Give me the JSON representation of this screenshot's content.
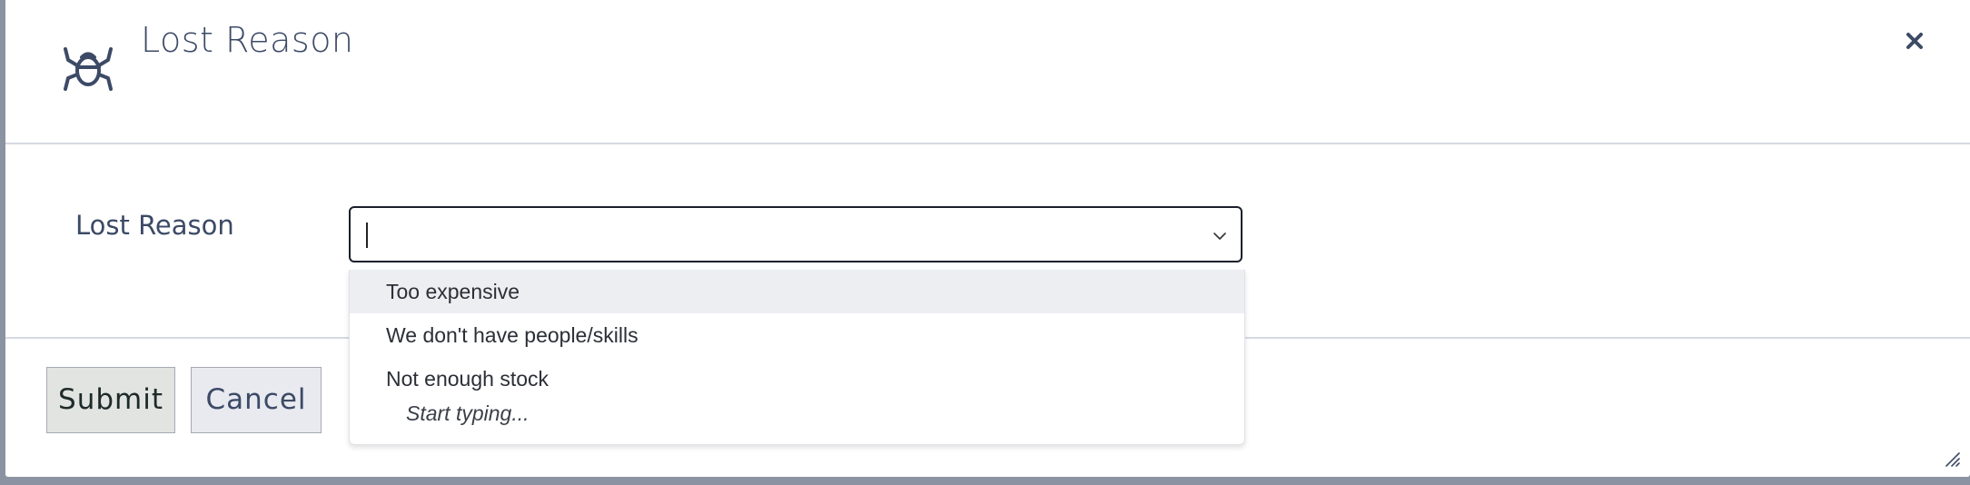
{
  "dialog": {
    "title": "Lost Reason",
    "header_icon": "bug-icon",
    "close_icon": "close-icon"
  },
  "form": {
    "field_label": "Lost Reason",
    "select_value": "",
    "select_icon": "chevron-down-icon"
  },
  "dropdown": {
    "options": [
      {
        "label": "Too expensive",
        "highlighted": true
      },
      {
        "label": "We don't have people/skills",
        "highlighted": false
      },
      {
        "label": "Not enough stock",
        "highlighted": false
      }
    ],
    "hint": "Start typing..."
  },
  "footer": {
    "submit_label": "Submit",
    "cancel_label": "Cancel"
  },
  "colors": {
    "title": "#3c4a66",
    "backdrop": "#8b93a3",
    "highlight": "#eceef2"
  }
}
